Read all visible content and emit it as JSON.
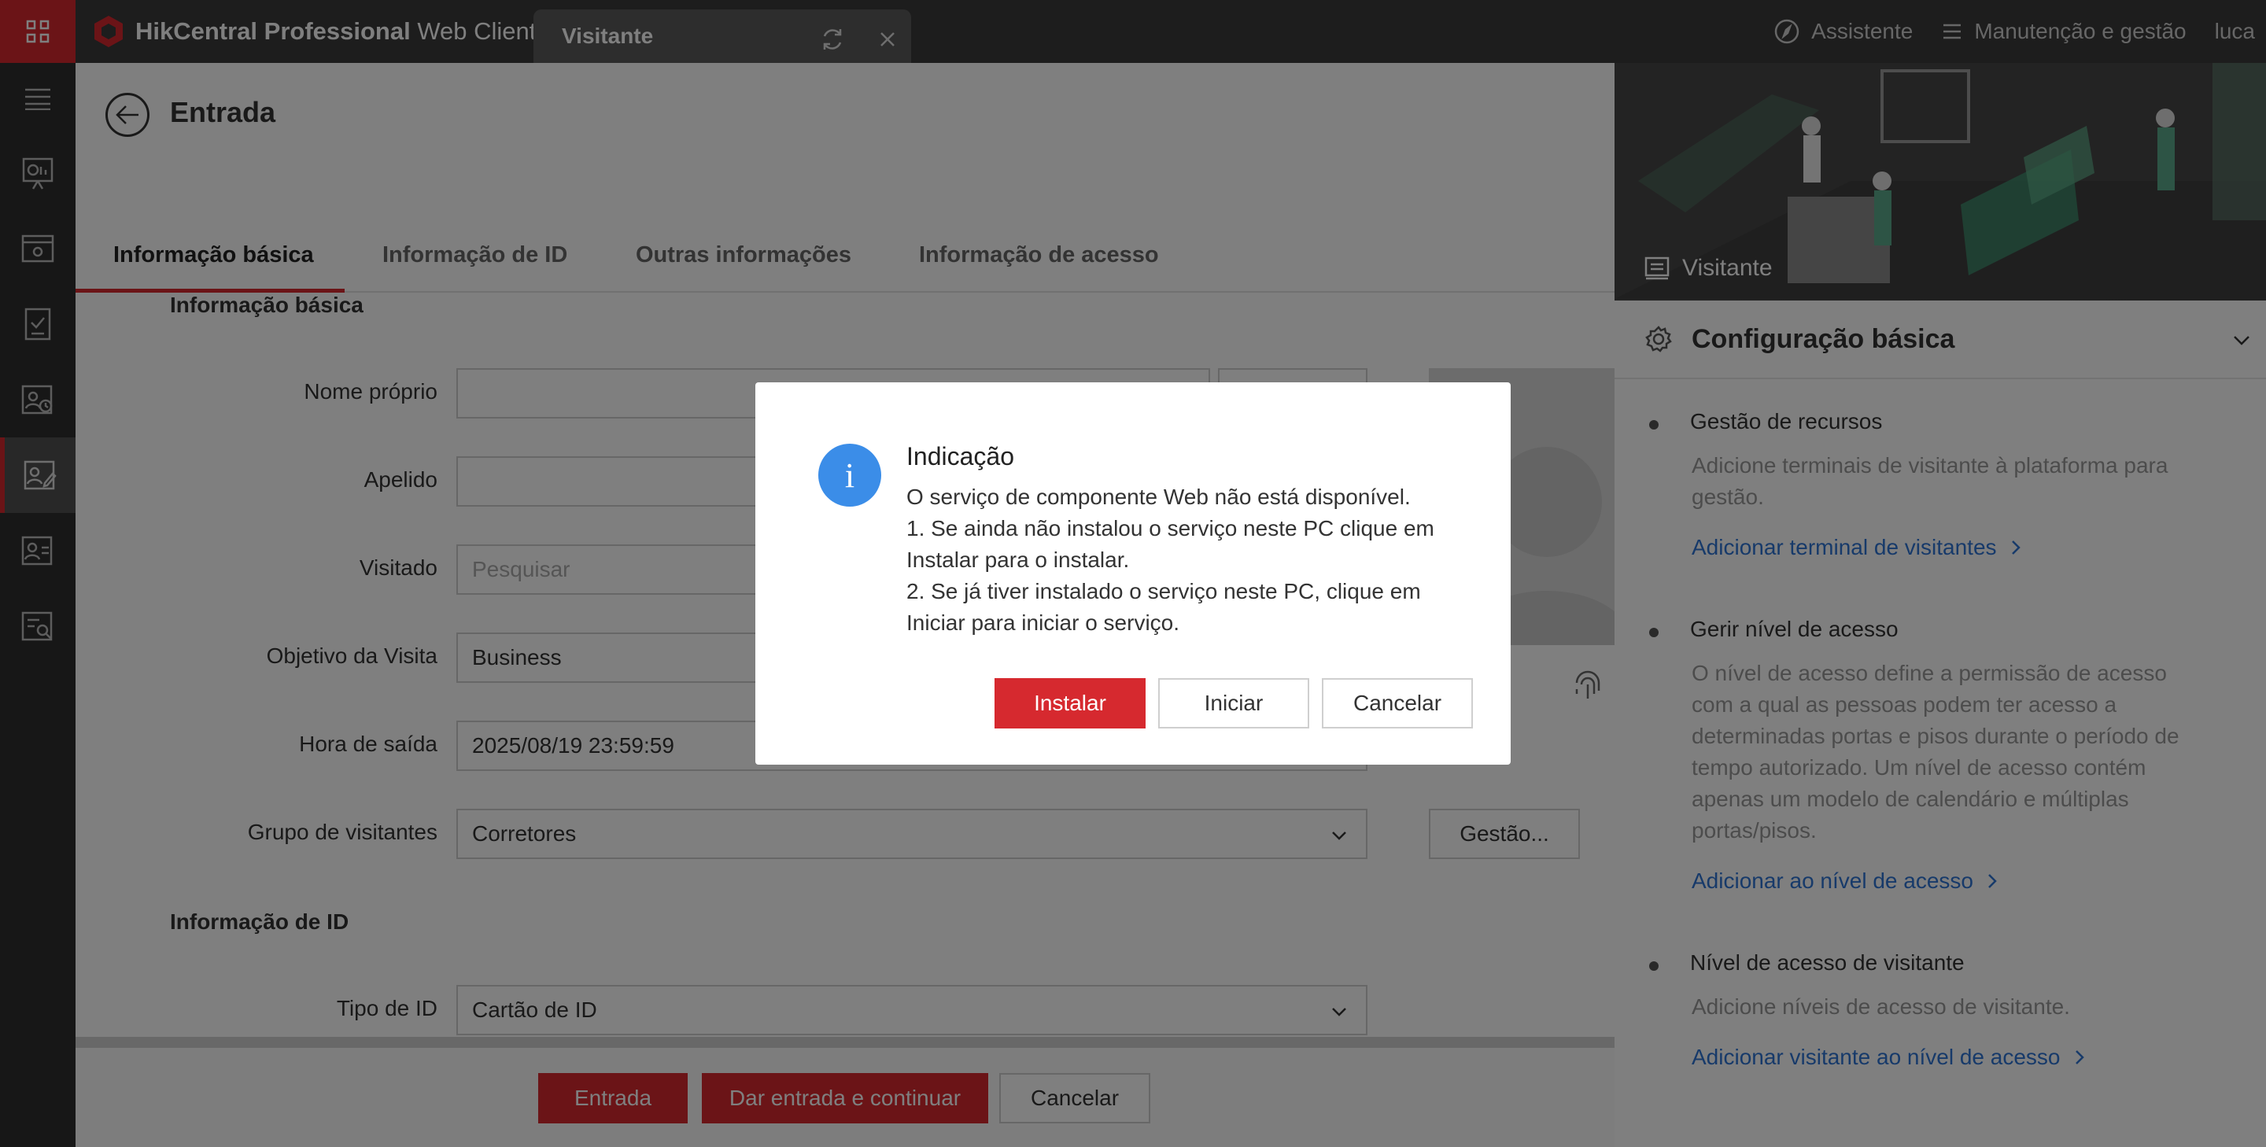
{
  "topbar": {
    "brand_bold": "HikCentral Professional",
    "brand_rest": " Web Client",
    "tab_label": "Visitante",
    "assistant": "Assistente",
    "maintenance": "Manutenção e gestão",
    "user": "luca",
    "brand_color": "#d6292f"
  },
  "page": {
    "title": "Entrada",
    "tabs": [
      "Informação básica",
      "Informação de ID",
      "Outras informações",
      "Informação de acesso"
    ]
  },
  "form": {
    "section_basic": "Informação básica",
    "first_name_label": "Nome próprio",
    "first_name_value": "",
    "last_name_label": "Apelido",
    "last_name_value": "",
    "visited_label": "Visitado",
    "visited_placeholder": "Pesquisar",
    "purpose_label": "Objetivo da Visita",
    "purpose_value": "Business",
    "exit_time_label": "Hora de saída",
    "exit_time_value": "2025/08/19 23:59:59",
    "group_label": "Grupo de visitantes",
    "group_value": "Corretores",
    "group_button": "Gestão...",
    "section_id": "Informação de ID",
    "id_type_label": "Tipo de ID",
    "id_type_value": "Cartão de ID"
  },
  "footer": {
    "entry": "Entrada",
    "entry_continue": "Dar entrada e continuar",
    "cancel": "Cancelar"
  },
  "right_panel": {
    "banner_label": "Visitante",
    "config_title": "Configuração básica",
    "sections": [
      {
        "title": "Gestão de recursos",
        "desc": [
          "Adicione terminais de visitante à plataforma para",
          "gestão."
        ],
        "link": "Adicionar terminal de visitantes"
      },
      {
        "title": "Gerir nível de acesso",
        "desc": [
          "O nível de acesso define a permissão de acesso",
          "com a qual as pessoas podem ter acesso a",
          "determinadas portas e pisos durante o período de",
          "tempo autorizado. Um nível de acesso contém",
          "apenas um modelo de calendário e múltiplas",
          "portas/pisos."
        ],
        "link": "Adicionar ao nível de acesso"
      },
      {
        "title": "Nível de acesso de visitante",
        "desc": [
          "Adicione níveis de acesso de visitante."
        ],
        "link": "Adicionar visitante ao nível de acesso"
      }
    ],
    "link_color": "#2e74d4"
  },
  "dialog": {
    "icon": "info-icon",
    "title": "Indicação",
    "lines": [
      "O serviço de componente Web não está disponível.",
      "1. Se ainda não instalou o serviço neste PC clique em",
      "Instalar para o instalar.",
      "2. Se já tiver instalado o serviço neste PC, clique em",
      "Iniciar para iniciar o serviço."
    ],
    "install": "Instalar",
    "start": "Iniciar",
    "cancel": "Cancelar"
  }
}
